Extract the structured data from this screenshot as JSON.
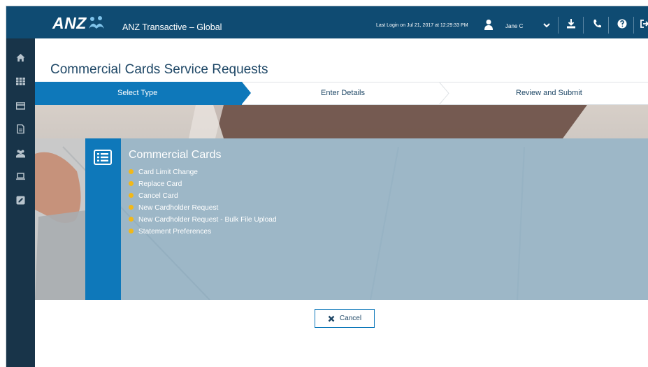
{
  "header": {
    "logo_text": "ANZ",
    "app_title": "ANZ Transactive – Global",
    "last_login": "Last Login on Jul 21, 2017 at 12:29:33 PM",
    "user_name": "Jane C",
    "icons": [
      "user-icon",
      "chevron-down-icon",
      "download-icon",
      "phone-icon",
      "help-icon",
      "logout-icon"
    ]
  },
  "sidebar": {
    "items": [
      {
        "icon": "home-icon"
      },
      {
        "icon": "apps-grid-icon"
      },
      {
        "icon": "card-icon"
      },
      {
        "icon": "document-icon"
      },
      {
        "icon": "users-icon"
      },
      {
        "icon": "laptop-icon"
      },
      {
        "icon": "edit-icon"
      }
    ]
  },
  "page": {
    "title": "Commercial Cards Service Requests"
  },
  "steps": [
    {
      "label": "Select Type",
      "active": true
    },
    {
      "label": "Enter Details",
      "active": false
    },
    {
      "label": "Review and Submit",
      "active": false
    }
  ],
  "panel": {
    "heading": "Commercial Cards",
    "items": [
      "Card Limit Change",
      "Replace Card",
      "Cancel Card",
      "New Cardholder Request",
      "New Cardholder Request - Bulk File Upload",
      "Statement Preferences"
    ]
  },
  "actions": {
    "cancel_label": "Cancel"
  },
  "colors": {
    "header_bg": "#0f4b72",
    "sidebar_bg": "#183449",
    "accent": "#0e78ba",
    "bullet": "#f2b818",
    "title": "#1e4766"
  }
}
